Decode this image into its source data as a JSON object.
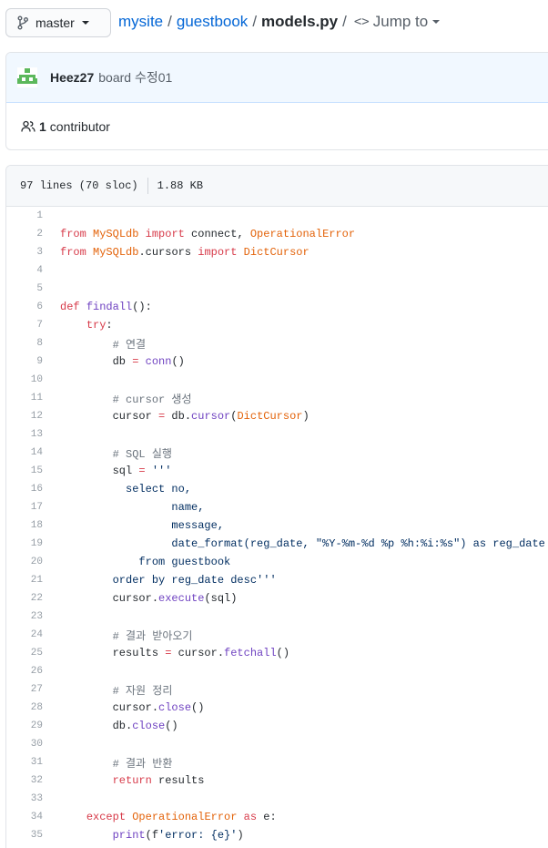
{
  "branch": {
    "label": "master"
  },
  "breadcrumb": {
    "repo": "mysite",
    "folder": "guestbook",
    "file": "models.py",
    "sep": "/",
    "jump": "Jump to"
  },
  "commit": {
    "author": "Heez27",
    "message": "board 수정01"
  },
  "contributors": {
    "count": "1",
    "label": "contributor"
  },
  "file_info": {
    "lines": "97 lines (70 sloc)",
    "size": "1.88 KB"
  },
  "code_lines": [
    {
      "n": "1",
      "t": []
    },
    {
      "n": "2",
      "t": [
        [
          "kw",
          "from "
        ],
        [
          "cls",
          "MySQLdb"
        ],
        [
          "kw",
          " import "
        ],
        [
          "",
          "connect, "
        ],
        [
          "cls",
          "OperationalError"
        ]
      ]
    },
    {
      "n": "3",
      "t": [
        [
          "kw",
          "from "
        ],
        [
          "cls",
          "MySQLdb"
        ],
        [
          "",
          ".cursors "
        ],
        [
          "kw",
          "import "
        ],
        [
          "cls",
          "DictCursor"
        ]
      ]
    },
    {
      "n": "4",
      "t": []
    },
    {
      "n": "5",
      "t": []
    },
    {
      "n": "6",
      "t": [
        [
          "kw",
          "def "
        ],
        [
          "fn",
          "findall"
        ],
        [
          "",
          "():"
        ]
      ]
    },
    {
      "n": "7",
      "t": [
        [
          "",
          "    "
        ],
        [
          "kw",
          "try"
        ],
        [
          "",
          ":"
        ]
      ]
    },
    {
      "n": "8",
      "t": [
        [
          "",
          "        "
        ],
        [
          "cm",
          "# 연결"
        ]
      ]
    },
    {
      "n": "9",
      "t": [
        [
          "",
          "        db "
        ],
        [
          "kw",
          "="
        ],
        [
          "",
          " "
        ],
        [
          "fn",
          "conn"
        ],
        [
          "",
          "()"
        ]
      ]
    },
    {
      "n": "10",
      "t": []
    },
    {
      "n": "11",
      "t": [
        [
          "",
          "        "
        ],
        [
          "cm",
          "# cursor 생성"
        ]
      ]
    },
    {
      "n": "12",
      "t": [
        [
          "",
          "        cursor "
        ],
        [
          "kw",
          "="
        ],
        [
          "",
          " db."
        ],
        [
          "fn",
          "cursor"
        ],
        [
          "",
          "("
        ],
        [
          "cls",
          "DictCursor"
        ],
        [
          "",
          ")"
        ]
      ]
    },
    {
      "n": "13",
      "t": []
    },
    {
      "n": "14",
      "t": [
        [
          "",
          "        "
        ],
        [
          "cm",
          "# SQL 실행"
        ]
      ]
    },
    {
      "n": "15",
      "t": [
        [
          "",
          "        sql "
        ],
        [
          "kw",
          "="
        ],
        [
          "",
          " "
        ],
        [
          "st",
          "'''"
        ]
      ]
    },
    {
      "n": "16",
      "t": [
        [
          "st",
          "          select no,"
        ]
      ]
    },
    {
      "n": "17",
      "t": [
        [
          "st",
          "                 name,"
        ]
      ]
    },
    {
      "n": "18",
      "t": [
        [
          "st",
          "                 message,"
        ]
      ]
    },
    {
      "n": "19",
      "t": [
        [
          "st",
          "                 date_format(reg_date, \"%Y-%m-%d %p %h:%i:%s\") as reg_date"
        ]
      ]
    },
    {
      "n": "20",
      "t": [
        [
          "st",
          "            from guestbook"
        ]
      ]
    },
    {
      "n": "21",
      "t": [
        [
          "st",
          "        order by reg_date desc'''"
        ]
      ]
    },
    {
      "n": "22",
      "t": [
        [
          "",
          "        cursor."
        ],
        [
          "fn",
          "execute"
        ],
        [
          "",
          "(sql)"
        ]
      ]
    },
    {
      "n": "23",
      "t": []
    },
    {
      "n": "24",
      "t": [
        [
          "",
          "        "
        ],
        [
          "cm",
          "# 결과 받아오기"
        ]
      ]
    },
    {
      "n": "25",
      "t": [
        [
          "",
          "        results "
        ],
        [
          "kw",
          "="
        ],
        [
          "",
          " cursor."
        ],
        [
          "fn",
          "fetchall"
        ],
        [
          "",
          "()"
        ]
      ]
    },
    {
      "n": "26",
      "t": []
    },
    {
      "n": "27",
      "t": [
        [
          "",
          "        "
        ],
        [
          "cm",
          "# 자원 정리"
        ]
      ]
    },
    {
      "n": "28",
      "t": [
        [
          "",
          "        cursor."
        ],
        [
          "fn",
          "close"
        ],
        [
          "",
          "()"
        ]
      ]
    },
    {
      "n": "29",
      "t": [
        [
          "",
          "        db."
        ],
        [
          "fn",
          "close"
        ],
        [
          "",
          "()"
        ]
      ]
    },
    {
      "n": "30",
      "t": []
    },
    {
      "n": "31",
      "t": [
        [
          "",
          "        "
        ],
        [
          "cm",
          "# 결과 반환"
        ]
      ]
    },
    {
      "n": "32",
      "t": [
        [
          "",
          "        "
        ],
        [
          "kw",
          "return"
        ],
        [
          "",
          " results"
        ]
      ]
    },
    {
      "n": "33",
      "t": []
    },
    {
      "n": "34",
      "t": [
        [
          "",
          "    "
        ],
        [
          "kw",
          "except "
        ],
        [
          "cls",
          "OperationalError"
        ],
        [
          "kw",
          " as "
        ],
        [
          "",
          "e:"
        ]
      ]
    },
    {
      "n": "35",
      "t": [
        [
          "",
          "        "
        ],
        [
          "fn",
          "print"
        ],
        [
          "",
          "(f"
        ],
        [
          "st",
          "'error: {e}'"
        ],
        [
          "",
          ")"
        ]
      ]
    }
  ]
}
